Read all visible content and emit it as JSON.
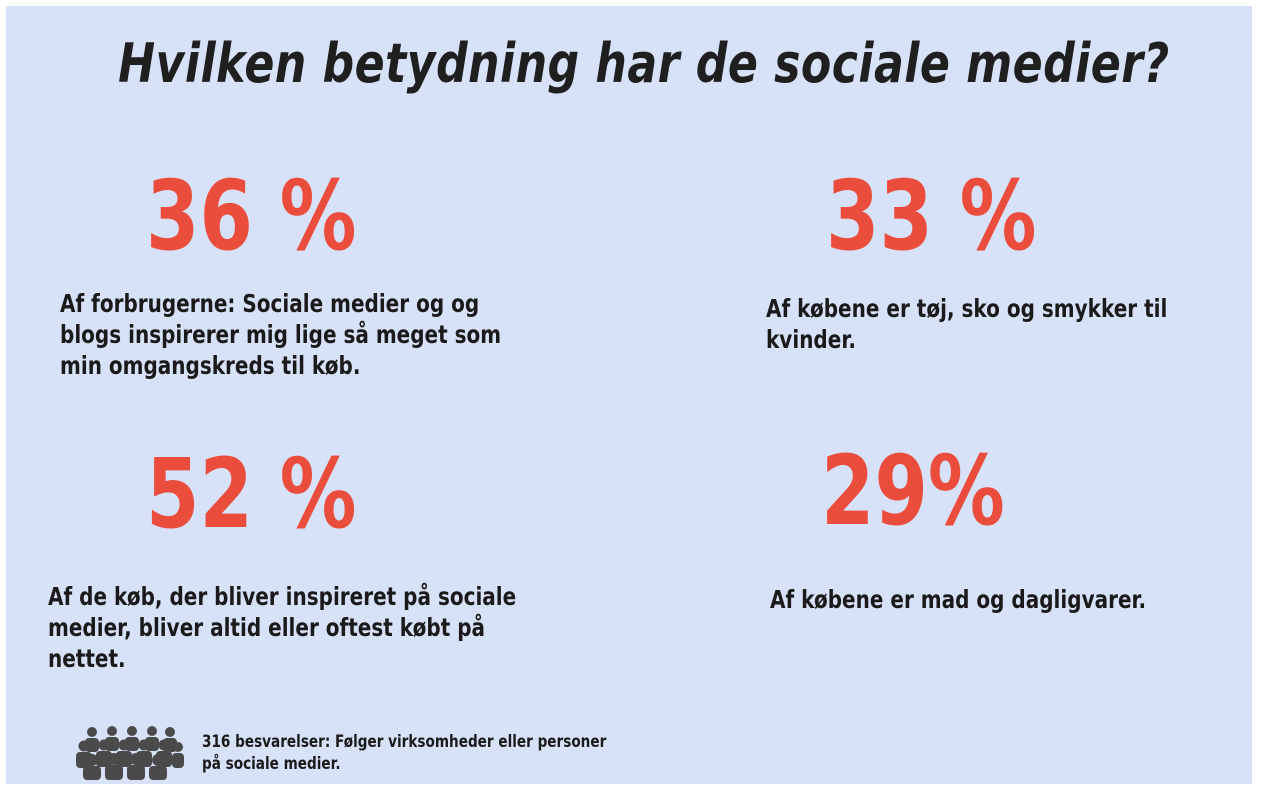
{
  "title": "Hvilken betydning har de sociale medier?",
  "stats": [
    {
      "value": "36 %",
      "text": "Af forbrugerne: Sociale medier og og blogs inspirerer mig lige så meget som min omgangskreds til køb."
    },
    {
      "value": "33 %",
      "text": "Af købene er tøj, sko og smykker til kvinder."
    },
    {
      "value": "52 %",
      "text": "Af de køb, der bliver inspireret på sociale medier, bliver altid eller oftest købt på nettet."
    },
    {
      "value": "29%",
      "text": "Af købene er mad og dagligvarer."
    }
  ],
  "footer": {
    "icon": "people-group-icon",
    "text": "316 besvarelser: Følger virksomheder eller personer på sociale medier."
  },
  "colors": {
    "background": "#d7e1f8",
    "accent": "#eb4d3d",
    "text": "#1a1a1a"
  }
}
